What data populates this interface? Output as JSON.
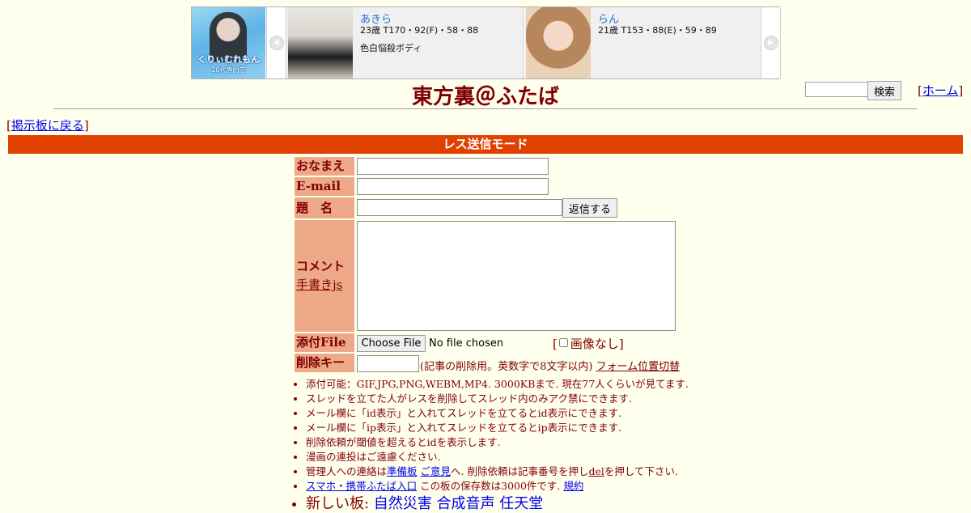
{
  "banner": {
    "logo_text": "くりぃむれもん",
    "logo_subtext": "20代専門店",
    "cards": [
      {
        "name": "あきら",
        "stats": "23歳 T170・92(F)・58・88",
        "catch": "色白悩殺ボディ"
      },
      {
        "name": "らん",
        "stats": "21歳 T153・88(E)・59・89",
        "catch": ""
      }
    ],
    "arrow_left": "◀",
    "arrow_right": "▶"
  },
  "header": {
    "title": "東方裏＠ふたば",
    "search_button": "検索",
    "search_value": "",
    "home_link": "ホーム",
    "back_link": "掲示板に戻る",
    "bracket_open": "[",
    "bracket_close": "]"
  },
  "mode_bar": "レス送信モード",
  "form": {
    "labels": {
      "name": "おなまえ",
      "email": "E-mail",
      "subject": "題　名",
      "comment": "コメント",
      "file": "添付File",
      "delkey": "削除キー"
    },
    "handwrite_link": "手書きjs",
    "reply_button": "返信する",
    "choose_file_button": "Choose File",
    "no_file_text": "No file chosen",
    "noimage_label": "画像なし",
    "delkey_note": "(記事の削除用。英数字で8文字以内)",
    "form_switch_link": "フォーム位置切替",
    "values": {
      "name": "",
      "email": "",
      "subject": "",
      "comment": "",
      "delkey": ""
    }
  },
  "notes": {
    "n1": "添付可能：GIF,JPG,PNG,WEBM,MP4. 3000KBまで. 現在77人くらいが見てます.",
    "n2": "スレッドを立てた人がレスを削除してスレッド内のみアク禁にできます.",
    "n3": "メール欄に「id表示」と入れてスレッドを立てるとid表示にできます.",
    "n4": "メール欄に「ip表示」と入れてスレッドを立てるとip表示にできます.",
    "n5": "削除依頼が閾値を超えるとidを表示します.",
    "n6": "漫画の連投はご遠慮ください.",
    "n7_prefix": "管理人への連絡は",
    "n7_link1": "準備板",
    "n7_link2": "ご意見",
    "n7_mid": "へ. 削除依頼は記事番号を押し",
    "n7_del": "del",
    "n7_suffix": "を押して下さい.",
    "n8_link": "スマホ・携帯ふたば入口",
    "n8_text": " この板の保存数は3000件です.",
    "n8_rules": "規約",
    "n9_prefix": "新しい板: ",
    "n9_boards": [
      "自然災害",
      "合成音声",
      "任天堂"
    ]
  }
}
